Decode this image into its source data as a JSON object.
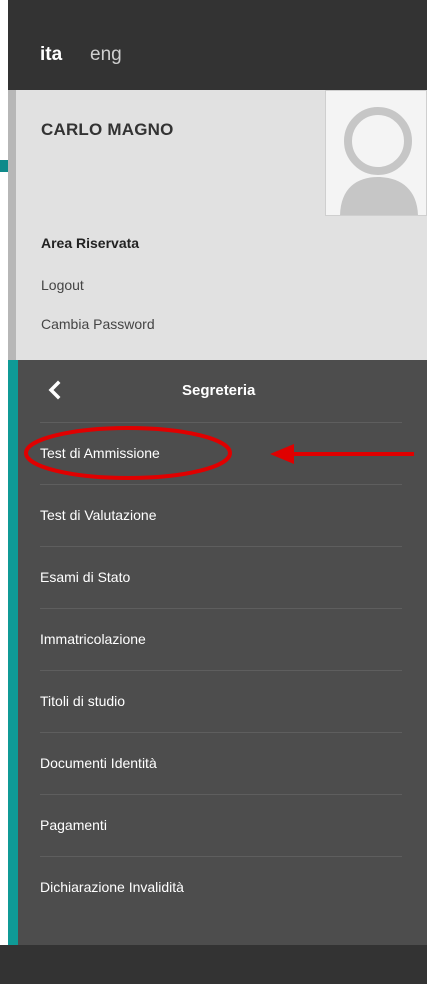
{
  "languages": {
    "ita": "ita",
    "eng": "eng"
  },
  "user": {
    "name": "CARLO MAGNO",
    "area_title": "Area Riservata",
    "logout": "Logout",
    "change_password": "Cambia Password"
  },
  "menu": {
    "title": "Segreteria",
    "items": [
      {
        "label": "Test di Ammissione"
      },
      {
        "label": "Test di Valutazione"
      },
      {
        "label": "Esami di Stato"
      },
      {
        "label": "Immatricolazione"
      },
      {
        "label": "Titoli di studio"
      },
      {
        "label": "Documenti Identità"
      },
      {
        "label": "Pagamenti"
      },
      {
        "label": "Dichiarazione Invalidità"
      }
    ]
  },
  "colors": {
    "accent_teal": "#0f9a96",
    "annotation_red": "#e00000",
    "menu_bg": "#4d4d4d",
    "header_bg": "#333333",
    "user_area_bg": "#e1e1e1"
  },
  "icons": {
    "back": "chevron-left-icon",
    "avatar": "user-silhouette-icon"
  }
}
